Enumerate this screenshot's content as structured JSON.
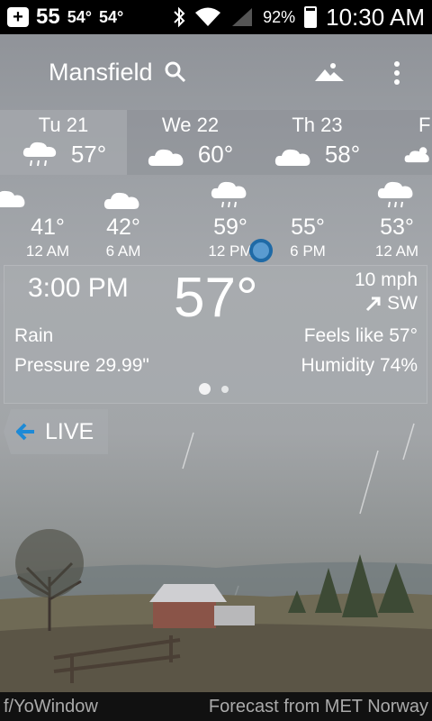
{
  "status_bar": {
    "notif_temp_1": "55",
    "notif_temp_2": "54°",
    "notif_temp_3": "54°",
    "battery": "92%",
    "time": "10:30 AM"
  },
  "header": {
    "city": "Mansfield"
  },
  "daily": [
    {
      "day": "Tu 21",
      "temp": "57°",
      "icon": "rain-cloud-icon"
    },
    {
      "day": "We 22",
      "temp": "60°",
      "icon": "cloud-icon"
    },
    {
      "day": "Th 23",
      "temp": "58°",
      "icon": "cloud-icon"
    },
    {
      "day": "F",
      "temp": "",
      "icon": "partly-sunny-icon"
    }
  ],
  "hourly": [
    {
      "temp": "41°",
      "time": "12 AM",
      "icon": "cloud-icon"
    },
    {
      "temp": "42°",
      "time": "6 AM",
      "icon": "cloud-icon"
    },
    {
      "temp": "59°",
      "time": "12 PM",
      "icon": "rain-cloud-icon"
    },
    {
      "temp": "55°",
      "time": "6 PM",
      "icon": ""
    },
    {
      "temp": "53°",
      "time": "12 AM",
      "icon": "rain-cloud-icon"
    }
  ],
  "current": {
    "time": "3:00 PM",
    "temp": "57°",
    "wind_speed": "10 mph",
    "wind_dir": "SW",
    "condition": "Rain",
    "pressure": "Pressure 29.99\"",
    "feels_like": "Feels like 57°",
    "humidity": "Humidity 74%"
  },
  "live_label": "LIVE",
  "footer": {
    "left": "f/YoWindow",
    "right": "Forecast from MET Norway"
  }
}
